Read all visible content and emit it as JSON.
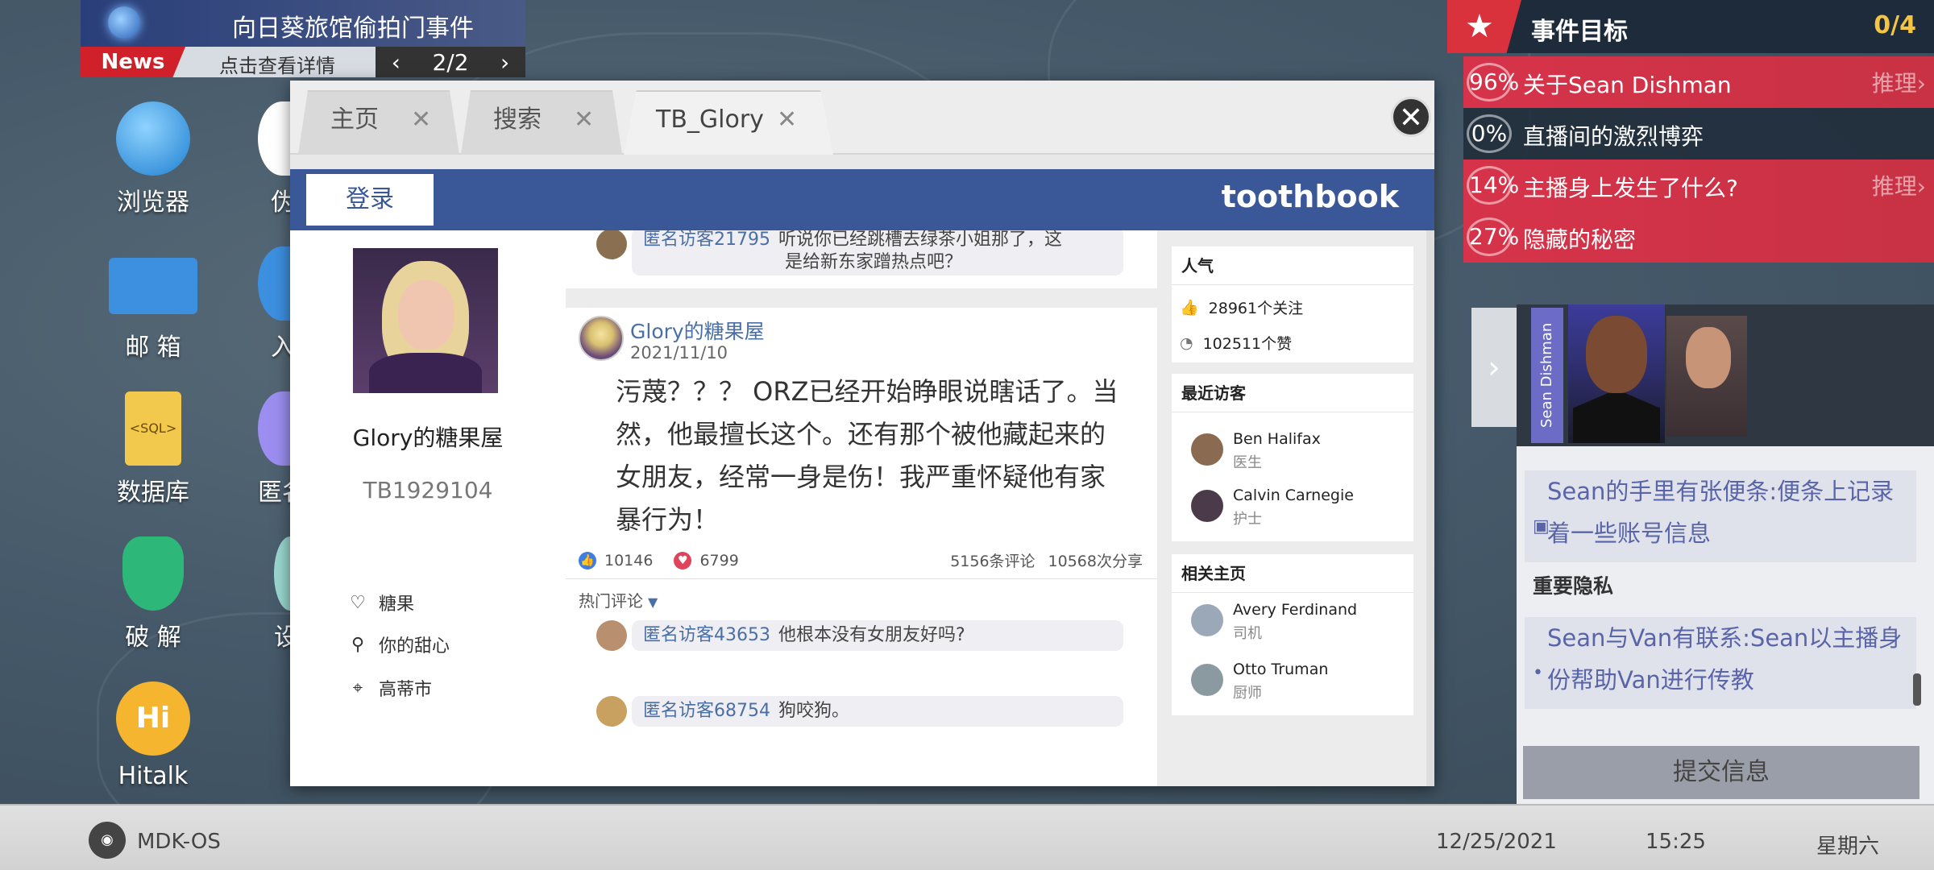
{
  "news": {
    "headline": "向日葵旅馆偷拍门事件",
    "tag": "News",
    "detail": "点击查看详情",
    "page": "2/2",
    "prev_icon": "chevron-left-icon",
    "next_icon": "chevron-right-icon"
  },
  "desktop_apps": [
    {
      "label": "浏览器",
      "icon": "globe-icon"
    },
    {
      "label": "邮 箱",
      "icon": "mail-icon"
    },
    {
      "label": "数据库",
      "icon": "sql-file-icon"
    },
    {
      "label": "破 解",
      "icon": "shield-key-icon"
    },
    {
      "label": "Hitalk",
      "icon": "hitalk-icon"
    }
  ],
  "desktop_apps_partial": [
    {
      "label": "伪"
    },
    {
      "label": "入"
    },
    {
      "label": "匿名"
    },
    {
      "label": "设"
    }
  ],
  "browser": {
    "tabs": [
      {
        "label": "主页"
      },
      {
        "label": "搜索"
      },
      {
        "label": "TB_Glory"
      }
    ],
    "login_label": "登录",
    "brand": "toothbook"
  },
  "profile": {
    "name": "Glory的糖果屋",
    "id": "TB1929104",
    "info": [
      {
        "icon": "heart-icon",
        "text": "糖果"
      },
      {
        "icon": "tie-icon",
        "text": "你的甜心"
      },
      {
        "icon": "location-icon",
        "text": "高蒂市"
      }
    ]
  },
  "feed": {
    "top_comment": {
      "user": "匿名访客21795",
      "text": "听说你已经跳槽去绿茶小姐那了，这",
      "text2": "是给新东家蹭热点吧？"
    },
    "post": {
      "author": "Glory的糖果屋",
      "date": "2021/11/10",
      "text": "污蔑？？？ ORZ已经开始睁眼说瞎话了。当然，他最擅长这个。还有那个被他藏起来的女朋友，经常一身是伤！我严重怀疑他有家暴行为！",
      "likes": "10146",
      "hearts": "6799",
      "comments": "5156条评论",
      "shares": "10568次分享",
      "hot_label": "热门评论",
      "replies": [
        {
          "user": "匿名访客43653",
          "text": "他根本没有女朋友好吗?"
        },
        {
          "user": "匿名访客68754",
          "text": "狗咬狗。"
        }
      ]
    }
  },
  "sidebar": {
    "popularity_title": "人气",
    "followers": "28961个关注",
    "likes": "102511个赞",
    "visitors_title": "最近访客",
    "visitors": [
      {
        "name": "Ben Halifax",
        "role": "医生"
      },
      {
        "name": "Calvin Carnegie",
        "role": "护士"
      }
    ],
    "related_title": "相关主页",
    "related": [
      {
        "name": "Avery Ferdinand",
        "role": "司机"
      },
      {
        "name": "Otto Truman",
        "role": "厨师"
      }
    ]
  },
  "goals": {
    "title": "事件目标",
    "count": "0/4",
    "items": [
      {
        "pct": "96%",
        "text": "关于Sean Dishman",
        "action": "推理›",
        "style": "red"
      },
      {
        "pct": "0%",
        "text": "直播间的激烈博弈",
        "action": "",
        "style": "dark"
      },
      {
        "pct": "14%",
        "text": "主播身上发生了什么?",
        "action": "推理›",
        "style": "red"
      },
      {
        "pct": "27%",
        "text": "隐藏的秘密",
        "action": "",
        "style": "red"
      }
    ]
  },
  "character": {
    "name": "Sean Dishman"
  },
  "clues": {
    "clue1": "Sean的手里有张便条:便条上记录着一些账号信息",
    "section": "重要隐私",
    "clue2": "Sean与Van有联系:Sean以主播身份帮助Van进行传教",
    "submit": "提交信息"
  },
  "taskbar": {
    "os": "MDK-OS",
    "date": "12/25/2021",
    "time": "15:25",
    "weekday": "星期六"
  },
  "colors": {
    "brand_blue": "#3a5898",
    "goal_red": "#d6334a",
    "link_blue": "#4a6fa5"
  }
}
